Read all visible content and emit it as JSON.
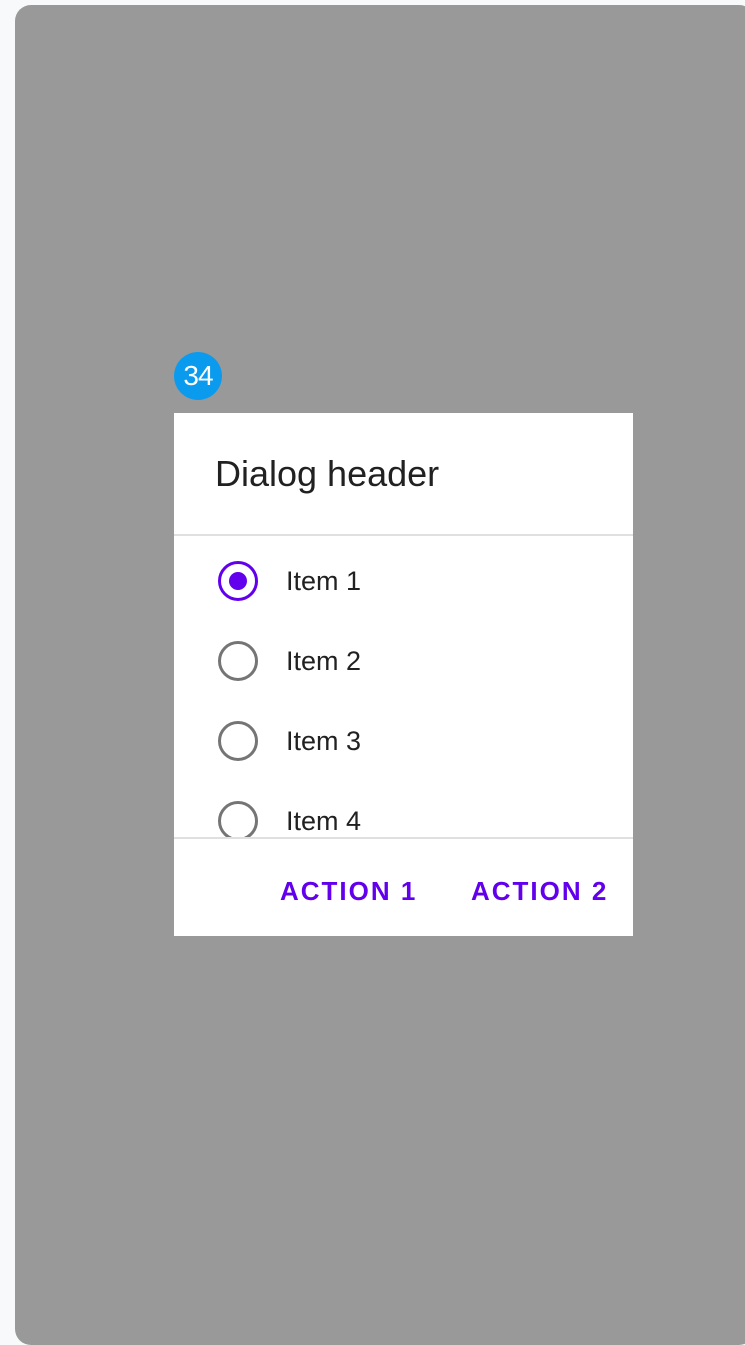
{
  "badge": {
    "number": "34",
    "color": "#0b9bee"
  },
  "dialog": {
    "header": "Dialog header",
    "options": [
      {
        "label": "Item 1",
        "selected": true
      },
      {
        "label": "Item 2",
        "selected": false
      },
      {
        "label": "Item 3",
        "selected": false
      },
      {
        "label": "Item 4",
        "selected": false
      }
    ],
    "actions": {
      "action_1": "ACTION 1",
      "action_2": "ACTION 2"
    }
  },
  "colors": {
    "accent": "#6200ee",
    "scrim": "#999999",
    "radio_unselected": "#757575",
    "divider": "#e0e0e0"
  }
}
